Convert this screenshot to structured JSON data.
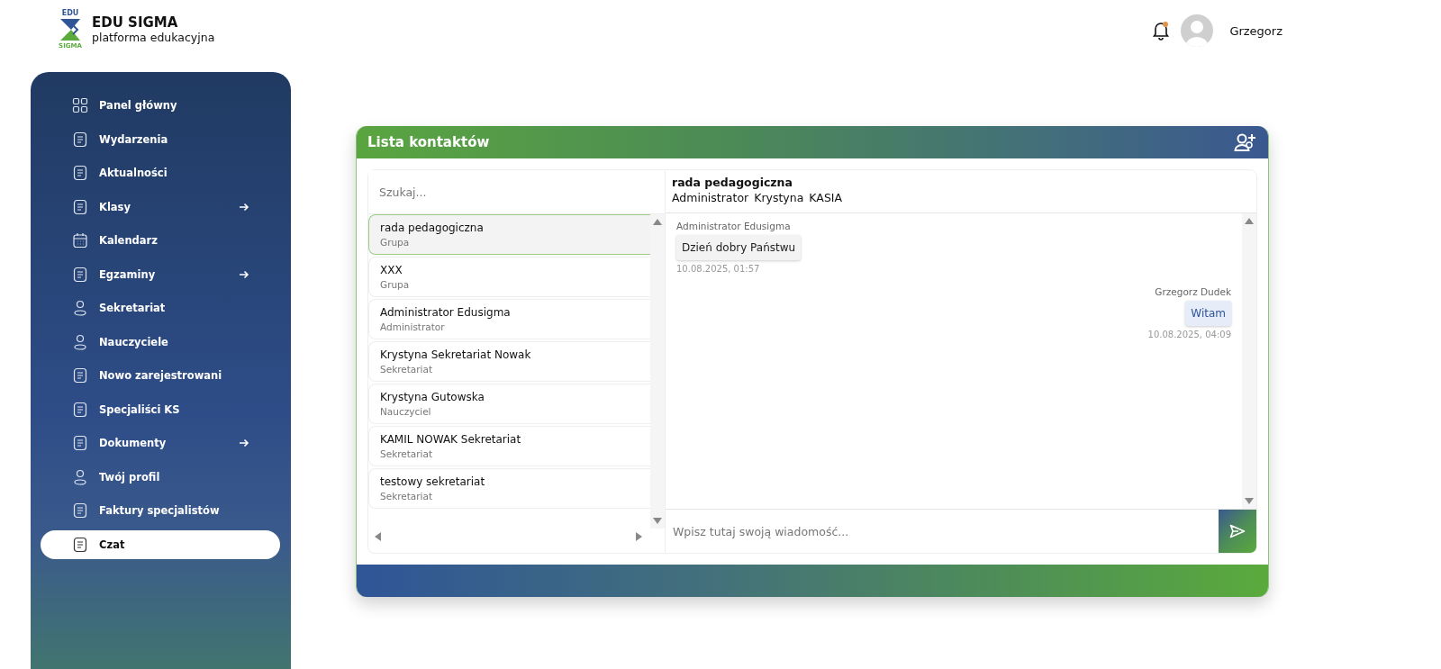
{
  "brand": {
    "logo_top": "EDU",
    "logo_bottom": "SIGMA",
    "name": "EDU SIGMA",
    "tagline": "platforma edukacyjna"
  },
  "user": {
    "name": "Grzegorz",
    "has_notification": true
  },
  "sidebar": {
    "items": [
      {
        "label": "Panel główny",
        "kind": "grid",
        "arrow": false,
        "selected": false
      },
      {
        "label": "Wydarzenia",
        "kind": "document",
        "arrow": false,
        "selected": false
      },
      {
        "label": "Aktualności",
        "kind": "document",
        "arrow": false,
        "selected": false
      },
      {
        "label": "Klasy",
        "kind": "document",
        "arrow": true,
        "selected": false
      },
      {
        "label": "Kalendarz",
        "kind": "calendar",
        "arrow": false,
        "selected": false
      },
      {
        "label": "Egzaminy",
        "kind": "document",
        "arrow": true,
        "selected": false
      },
      {
        "label": "Sekretariat",
        "kind": "person",
        "arrow": false,
        "selected": false
      },
      {
        "label": "Nauczyciele",
        "kind": "person",
        "arrow": false,
        "selected": false
      },
      {
        "label": "Nowo zarejestrowani",
        "kind": "document",
        "arrow": false,
        "selected": false
      },
      {
        "label": "Specjaliści KS",
        "kind": "document",
        "arrow": false,
        "selected": false
      },
      {
        "label": "Dokumenty",
        "kind": "document",
        "arrow": true,
        "selected": false
      },
      {
        "label": "Twój profil",
        "kind": "person",
        "arrow": false,
        "selected": false
      },
      {
        "label": "Faktury specjalistów",
        "kind": "document",
        "arrow": false,
        "selected": false
      },
      {
        "label": "Czat",
        "kind": "document",
        "arrow": false,
        "selected": true
      }
    ]
  },
  "contacts_panel": {
    "title": "Lista kontaktów",
    "search": {
      "placeholder": "Szukaj..."
    },
    "contacts": [
      {
        "name": "rada pedagogiczna",
        "role": "Grupa",
        "selected": true
      },
      {
        "name": "XXX",
        "role": "Grupa",
        "selected": false
      },
      {
        "name": "Administrator Edusigma",
        "role": "Administrator",
        "selected": false
      },
      {
        "name": "Krystyna Sekretariat Nowak",
        "role": "Sekretariat",
        "selected": false
      },
      {
        "name": "Krystyna Gutowska",
        "role": "Nauczyciel",
        "selected": false
      },
      {
        "name": "KAMIL NOWAK Sekretariat",
        "role": "Sekretariat",
        "selected": false
      },
      {
        "name": "testowy sekretariat",
        "role": "Sekretariat",
        "selected": false
      }
    ]
  },
  "chat": {
    "title": "rada pedagogiczna",
    "participants": [
      "Administrator",
      "Krystyna",
      "KASIA"
    ],
    "messages": [
      {
        "kind": "received",
        "sender": "Administrator Edusigma",
        "text": "Dzień dobry Państwu",
        "time": "10.08.2025, 01:57"
      },
      {
        "kind": "sent",
        "sender": "Grzegorz Dudek",
        "text": "Witam",
        "time": "10.08.2025, 04:09"
      }
    ],
    "input": {
      "placeholder": "Wpisz tutaj swoją wiadomość..."
    }
  }
}
